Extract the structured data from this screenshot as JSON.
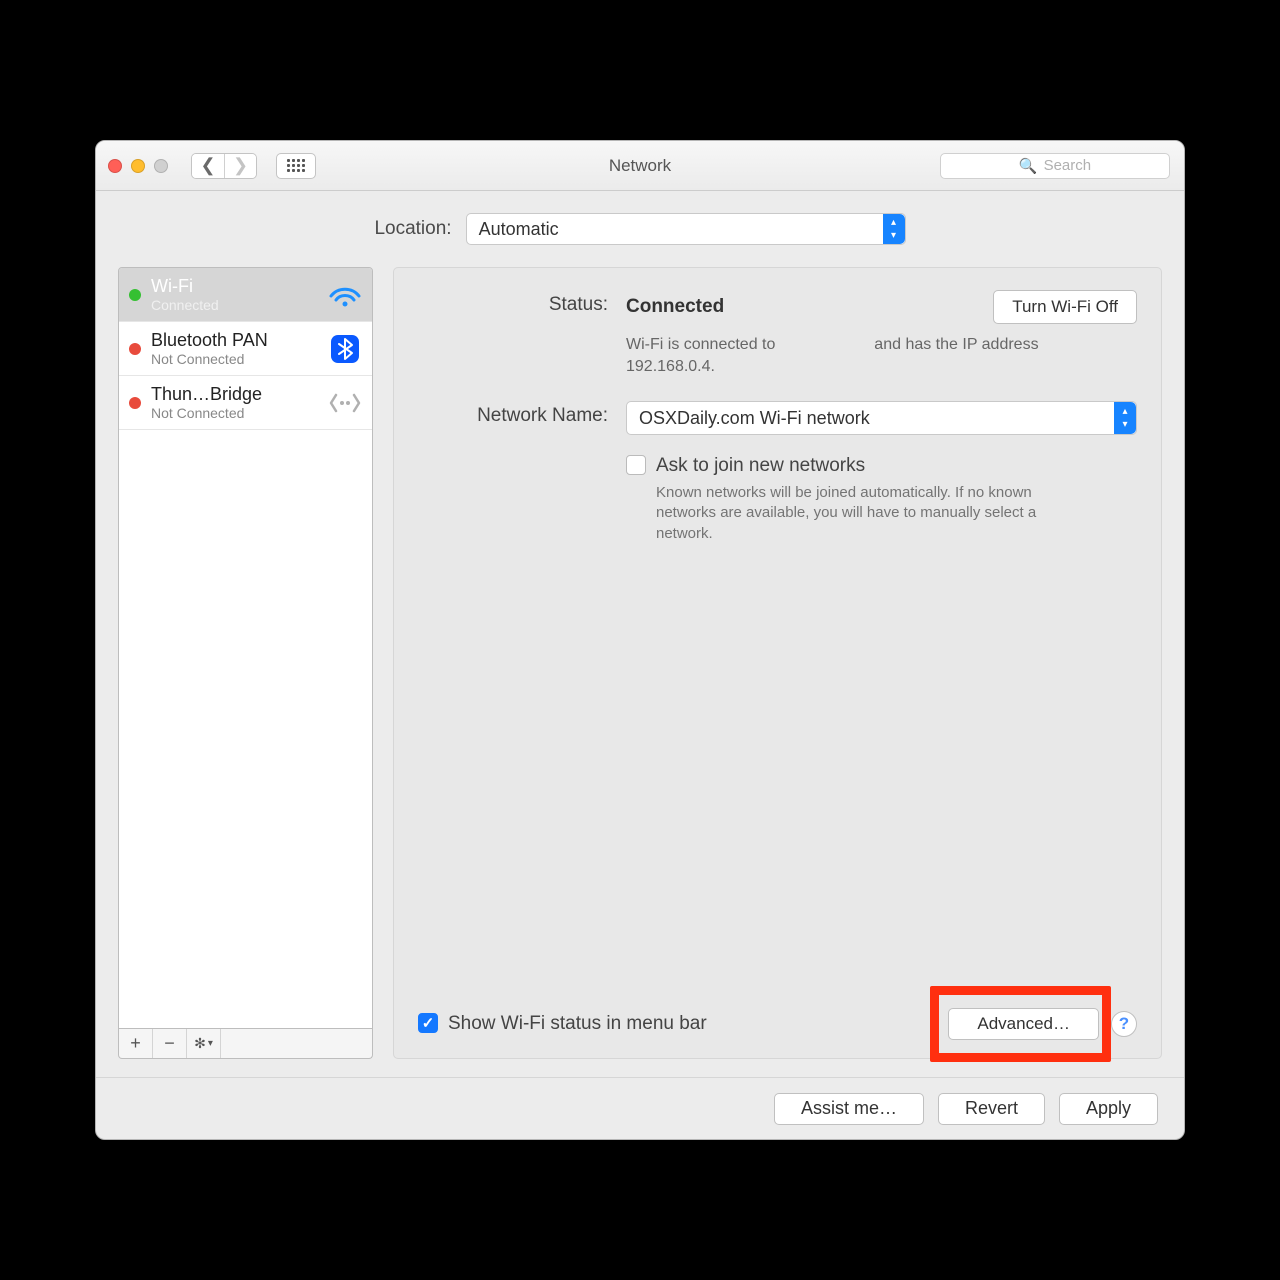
{
  "window": {
    "title": "Network"
  },
  "toolbar": {
    "search_placeholder": "Search"
  },
  "location": {
    "label": "Location:",
    "value": "Automatic"
  },
  "services": [
    {
      "name": "Wi-Fi",
      "status": "Connected",
      "status_dot": "green",
      "selected": true,
      "icon": "wifi"
    },
    {
      "name": "Bluetooth PAN",
      "status": "Not Connected",
      "status_dot": "red",
      "selected": false,
      "icon": "bluetooth"
    },
    {
      "name": "Thun…Bridge",
      "status": "Not Connected",
      "status_dot": "red",
      "selected": false,
      "icon": "thunderbolt-bridge"
    }
  ],
  "detail": {
    "status_label": "Status:",
    "status_value": "Connected",
    "wifi_toggle_label": "Turn Wi-Fi Off",
    "status_desc_line1": "Wi-Fi is connected to",
    "status_desc_line2": "and has the IP address 192.168.0.4.",
    "network_name_label": "Network Name:",
    "network_name_value": "OSXDaily.com Wi-Fi network",
    "ask_join_label": "Ask to join new networks",
    "ask_join_checked": false,
    "ask_join_hint": "Known networks will be joined automatically. If no known networks are available, you will have to manually select a network.",
    "show_menubar_label": "Show Wi-Fi status in menu bar",
    "show_menubar_checked": true,
    "advanced_label": "Advanced…"
  },
  "footer": {
    "assist_label": "Assist me…",
    "revert_label": "Revert",
    "apply_label": "Apply"
  }
}
